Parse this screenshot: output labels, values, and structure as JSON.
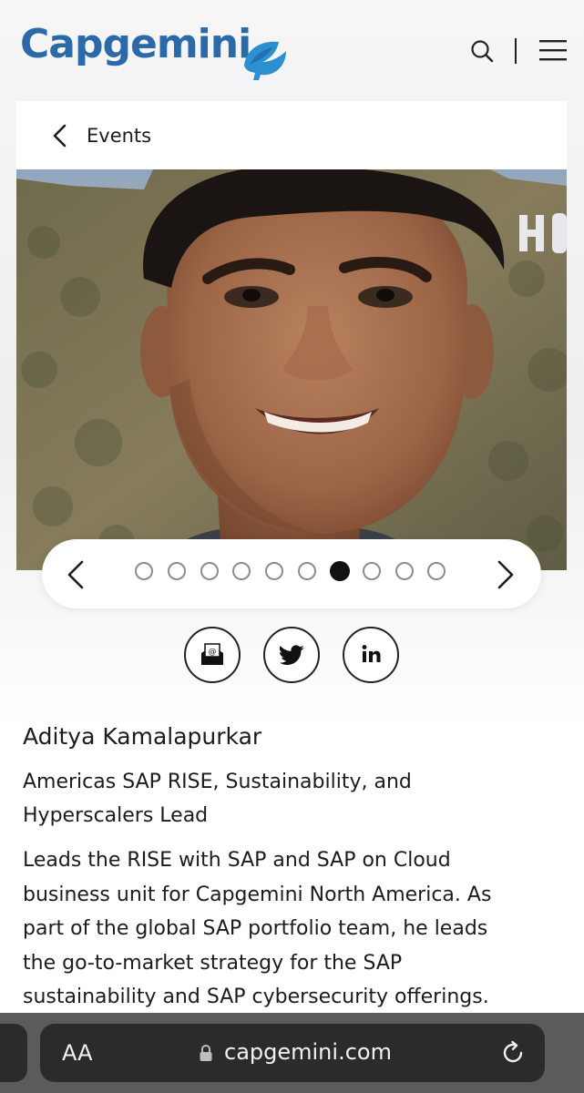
{
  "header": {
    "logo_text": "Capgemini",
    "icons": [
      "search-icon",
      "menu-icon"
    ]
  },
  "nav": {
    "back_label": "Events"
  },
  "carousel": {
    "total_slides": 10,
    "active_slide": 7
  },
  "share": {
    "icons": [
      "email-icon",
      "twitter-icon",
      "linkedin-icon"
    ]
  },
  "person": {
    "name": "Aditya Kamalapurkar",
    "role_line1": "Americas SAP RISE, Sustainability, and",
    "role_line2": "Hyperscalers Lead",
    "bio_lines": [
      "Leads the RISE with SAP and SAP on Cloud",
      "business unit for Capgemini North America. As",
      "part of the global SAP portfolio team, he leads",
      "the go-to-market strategy for the SAP",
      "sustainability and SAP cybersecurity offerings."
    ]
  },
  "browser": {
    "text_size_label": "AA",
    "url": "capgemini.com"
  },
  "colors": {
    "brand_blue": "#2b6aa8",
    "browser_bar": "#5b5b5e",
    "url_pill": "#2b2b2d"
  }
}
